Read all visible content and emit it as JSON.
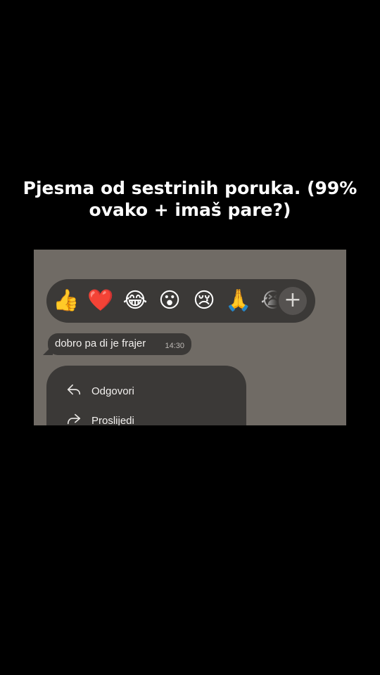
{
  "caption": {
    "line1": "Pjesma od sestrinih poruka. (99%",
    "line2": "ovako + imaš pare?)"
  },
  "reactions": {
    "items": [
      {
        "name": "thumbs-up-icon",
        "glyph": "👍"
      },
      {
        "name": "red-heart-icon",
        "glyph": "❤️"
      },
      {
        "name": "tears-of-joy-icon",
        "glyph": "😂"
      },
      {
        "name": "surprised-face-icon",
        "glyph": "😮"
      },
      {
        "name": "crying-face-icon",
        "glyph": "😢"
      },
      {
        "name": "folded-hands-icon",
        "glyph": "🙏"
      },
      {
        "name": "loudly-crying-face-icon",
        "glyph": "😭"
      }
    ],
    "more": "+"
  },
  "message": {
    "text": "dobro pa di je frajer",
    "time": "14:30"
  },
  "menu": {
    "reply_label": "Odgovori",
    "forward_label": "Proslijedi"
  },
  "colors": {
    "background": "#000000",
    "chat_background": "#706b65",
    "surface": "#3b3937"
  }
}
